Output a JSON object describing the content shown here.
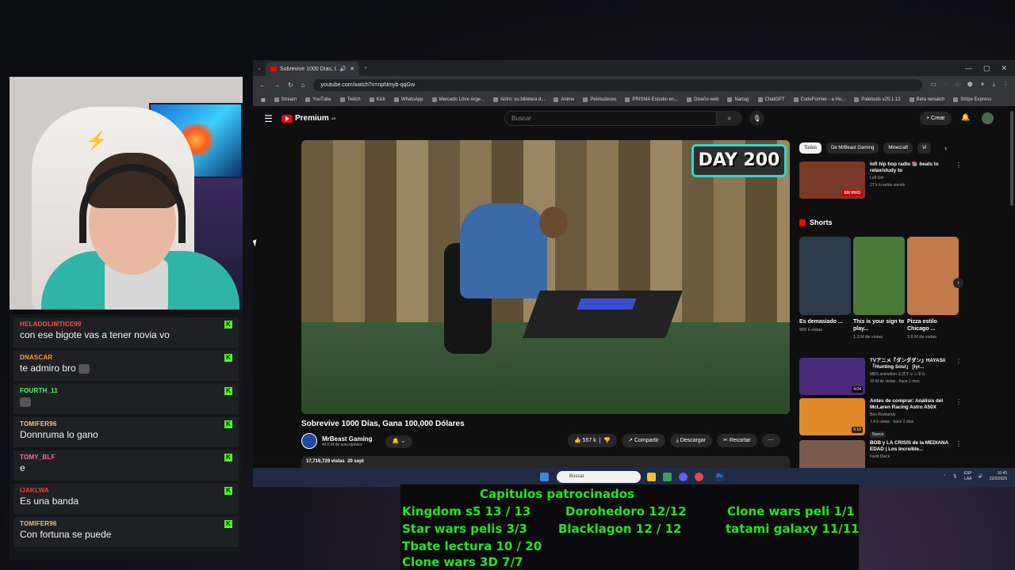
{
  "browser": {
    "tab_title": "Sobrevive 1000 Días, Gana",
    "url": "youtube.com/watch?v=npNmyb-qqGw",
    "bookmarks": [
      "Stream",
      "YouTube",
      "Twitch",
      "Kick",
      "WhatsApp",
      "Mercado Libre Arge...",
      "Airtm: su billetera d...",
      "Anime",
      "Pelotudeces",
      "PRISMA Estudio en...",
      "Diseño web",
      "Nartag",
      "ChatGPT",
      "CodeFormer - a Hu...",
      "Paletools v25.1.12",
      "Beta rematch",
      "Stripe Express"
    ]
  },
  "youtube": {
    "logo": "Premium",
    "logo_sup": "AR",
    "search_placeholder": "Buscar",
    "create_label": "Crear",
    "video": {
      "overlay": "DAY 200",
      "title": "Sobrevive 1000 Días, Gana 100,000 Dólares",
      "channel": "MrBeast Gaming",
      "subscribers": "49.6 M de suscriptores",
      "likes": "557 k",
      "share": "Compartir",
      "download": "Descargar",
      "clip": "Recortar",
      "views": "17,716,729 vistas",
      "date": "20 sept"
    },
    "chips": [
      "Todos",
      "De MrBeast Gaming",
      "Minecraft",
      "Vi"
    ],
    "shorts_label": "Shorts",
    "recs": [
      {
        "title": "lofi hip hop radio 📚 beats to relax/study to",
        "channel": "Lofi Girl",
        "meta": "27 k lo están viendo",
        "badge": "EN VIVO",
        "color": "#7a3a2a"
      },
      {
        "title": "TVアニメ『ダンダダン』HAYASii「Hunting Soul」 [lyr...",
        "channel": "MBS animation 公式チャンネル",
        "meta": "15 M de vistas · hace 1 mes",
        "badge": "4:04",
        "color": "#4a2a7a"
      },
      {
        "title": "Antes de comprar: Análisis del McLaren Racing Astro A50X",
        "channel": "Ben Rowlands",
        "meta": "1.4 k vistas · hace 2 días",
        "badge": "6:10",
        "extra": "Nuevo",
        "color": "#e08a2a"
      },
      {
        "title": "BOB y LA CRISIS de la MEDIANA EDAD | Los Increíble...",
        "channel": "Farid Dieck",
        "meta": "",
        "badge": "",
        "color": "#7a5a4a"
      }
    ],
    "shorts": [
      {
        "title": "Es demasiado ...",
        "views": "999 k vistas",
        "color": "#2c3a4a"
      },
      {
        "title": "This is your sign to play...",
        "views": "1.3 M de vistas",
        "color": "#4a7a3a"
      },
      {
        "title": "Pizza estilo Chicago ...",
        "views": "3.6 M de vistas",
        "color": "#c27a4a"
      }
    ]
  },
  "chat": [
    {
      "user": "HELADOLIMTICE99",
      "text": "con ese bigote vas a tener novia vo",
      "color": "#ff4a4a"
    },
    {
      "user": "DNASCAR",
      "text": "te admiro bro",
      "color": "#ff9a3a",
      "emote": true
    },
    {
      "user": "FOURTH_11",
      "text": "",
      "color": "#4aff6a",
      "emote": true
    },
    {
      "user": "TOMIFER96",
      "text": "Donnruma lo gano",
      "color": "#f0c080"
    },
    {
      "user": "TOMY_BLF",
      "text": "e",
      "color": "#ff6a9a"
    },
    {
      "user": "IJAKLWA",
      "text": "Es una banda",
      "color": "#ff3a3a"
    },
    {
      "user": "TOMIFER96",
      "text": "Con fortuna se puede",
      "color": "#f0c080"
    }
  ],
  "taskbar": {
    "search": "Buscar",
    "lang": "ESP",
    "lang2": "LAA",
    "time": "16:45",
    "date": "22/9/2025"
  },
  "overlay_list": {
    "title": "Capitulos patrocinados",
    "items": [
      "Kingdom s5 13 / 13",
      "Dorohedoro 12/12",
      "Clone wars peli 1/1",
      "Star wars pelis 3/3",
      "Blacklagon 12 / 12",
      "tatami galaxy 11/11",
      "Tbate lectura 10 / 20",
      "Clone wars 3D 7/7"
    ]
  }
}
